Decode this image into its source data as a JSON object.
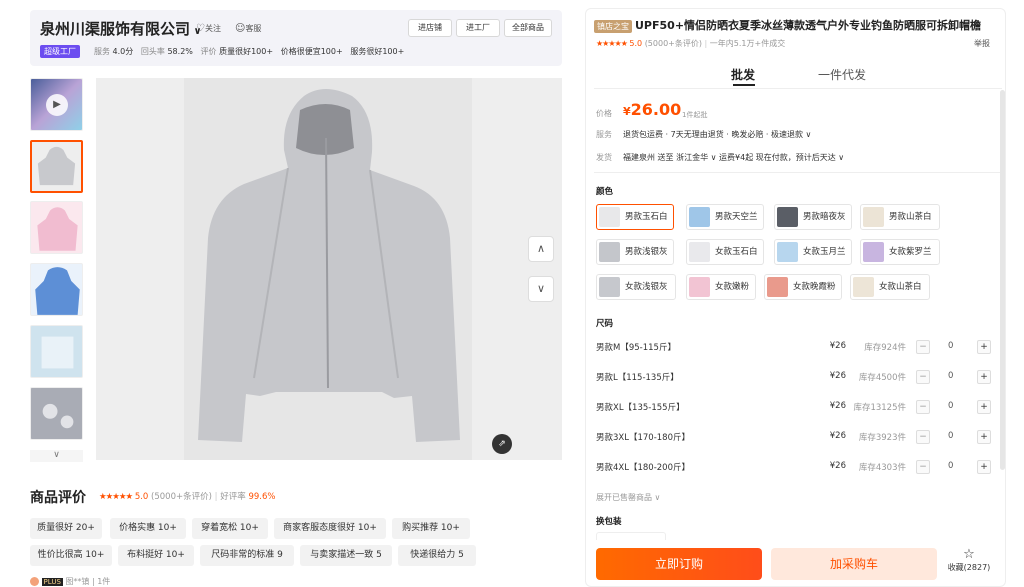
{
  "shop": {
    "name": "泉州川渠服饰有限公司",
    "follow": "关注",
    "service": "客服",
    "btn_store": "进店铺",
    "btn_factory": "进工厂",
    "btn_all": "全部商品",
    "badge": "超级工厂",
    "stats": [
      {
        "label": "服务",
        "value": "4.0分"
      },
      {
        "label": "回头率",
        "value": "58.2%"
      },
      {
        "label": "评价",
        "value": "质量很好100+"
      },
      {
        "label": "",
        "value": "价格很便宜100+"
      },
      {
        "label": "",
        "value": "服务很好100+"
      }
    ]
  },
  "reviews": {
    "title": "商品评价",
    "score": "5.0",
    "count": "(5000+条评价)",
    "good_rate_label": "好评率",
    "good_rate": "99.6%",
    "tags": [
      "质量很好 20+",
      "价格实惠 10+",
      "穿着宽松 10+",
      "商家客服态度很好 10+",
      "购买推荐 10+",
      "性价比很高 10+",
      "布料挺好 10+",
      "尺码非常的标准 9",
      "与卖家描述一致 5",
      "快递很给力 5"
    ],
    "reviewer_badge": "PLUS",
    "reviewer": "图**镇",
    "reviewer_count": "1件"
  },
  "product": {
    "shop_tag": "镇店之宝",
    "title": "UPF50+情侣防晒衣夏季冰丝薄款透气户外专业钓鱼防晒服可拆卸帽檐",
    "rating": "5.0",
    "reviews": "(5000+条评价)",
    "sales": "一年内5.1万+件成交",
    "report": "举报",
    "tab_wholesale": "批发",
    "tab_dropship": "一件代发",
    "price_label": "价格",
    "currency": "¥",
    "price": "26.00",
    "min_order": "1件起批",
    "service_label": "服务",
    "service_text": "退货包运费 · 7天无理由退货 · 晚发必赔 · 极速退款",
    "ship_label": "发货",
    "ship_text": "福建泉州 送至 浙江金华 ∨ 运费¥4起 现在付款，预计后天达",
    "color_label": "颜色",
    "colors": [
      {
        "name": "男款玉石白",
        "c": "#e8e8ea"
      },
      {
        "name": "男款天空兰",
        "c": "#9fc6e8"
      },
      {
        "name": "男款暗夜灰",
        "c": "#5a5e66"
      },
      {
        "name": "男款山茶白",
        "c": "#ece4d6"
      },
      {
        "name": "男款浅银灰",
        "c": "#c4c6cb"
      },
      {
        "name": "女款玉石白",
        "c": "#e9e9ec"
      },
      {
        "name": "女款玉月兰",
        "c": "#b7d6ee"
      },
      {
        "name": "女款紫罗兰",
        "c": "#c8b5e0"
      },
      {
        "name": "女款浅银灰",
        "c": "#c6c8cd"
      },
      {
        "name": "女款嫩粉",
        "c": "#f2c4d3"
      },
      {
        "name": "女款晚霞粉",
        "c": "#e99a8c"
      },
      {
        "name": "女款山茶白",
        "c": "#ede5d7"
      }
    ],
    "size_label": "尺码",
    "sizes": [
      {
        "name": "男款M【95-115斤】",
        "price": "¥26",
        "stock": "库存924件",
        "qty": "0"
      },
      {
        "name": "男款L【115-135斤】",
        "price": "¥26",
        "stock": "库存4500件",
        "qty": "0"
      },
      {
        "name": "男款XL【135-155斤】",
        "price": "¥26",
        "stock": "库存13125件",
        "qty": "0"
      },
      {
        "name": "男款3XL【170-180斤】",
        "price": "¥26",
        "stock": "库存3923件",
        "qty": "0"
      },
      {
        "name": "男款4XL【180-200斤】",
        "price": "¥26",
        "stock": "库存4303件",
        "qty": "0"
      }
    ],
    "expand": "展开已售罄商品 ∨",
    "pack_label": "换包装",
    "btn_order": "立即订购",
    "btn_cart": "加采购车",
    "favorite": "收藏(2827)"
  }
}
